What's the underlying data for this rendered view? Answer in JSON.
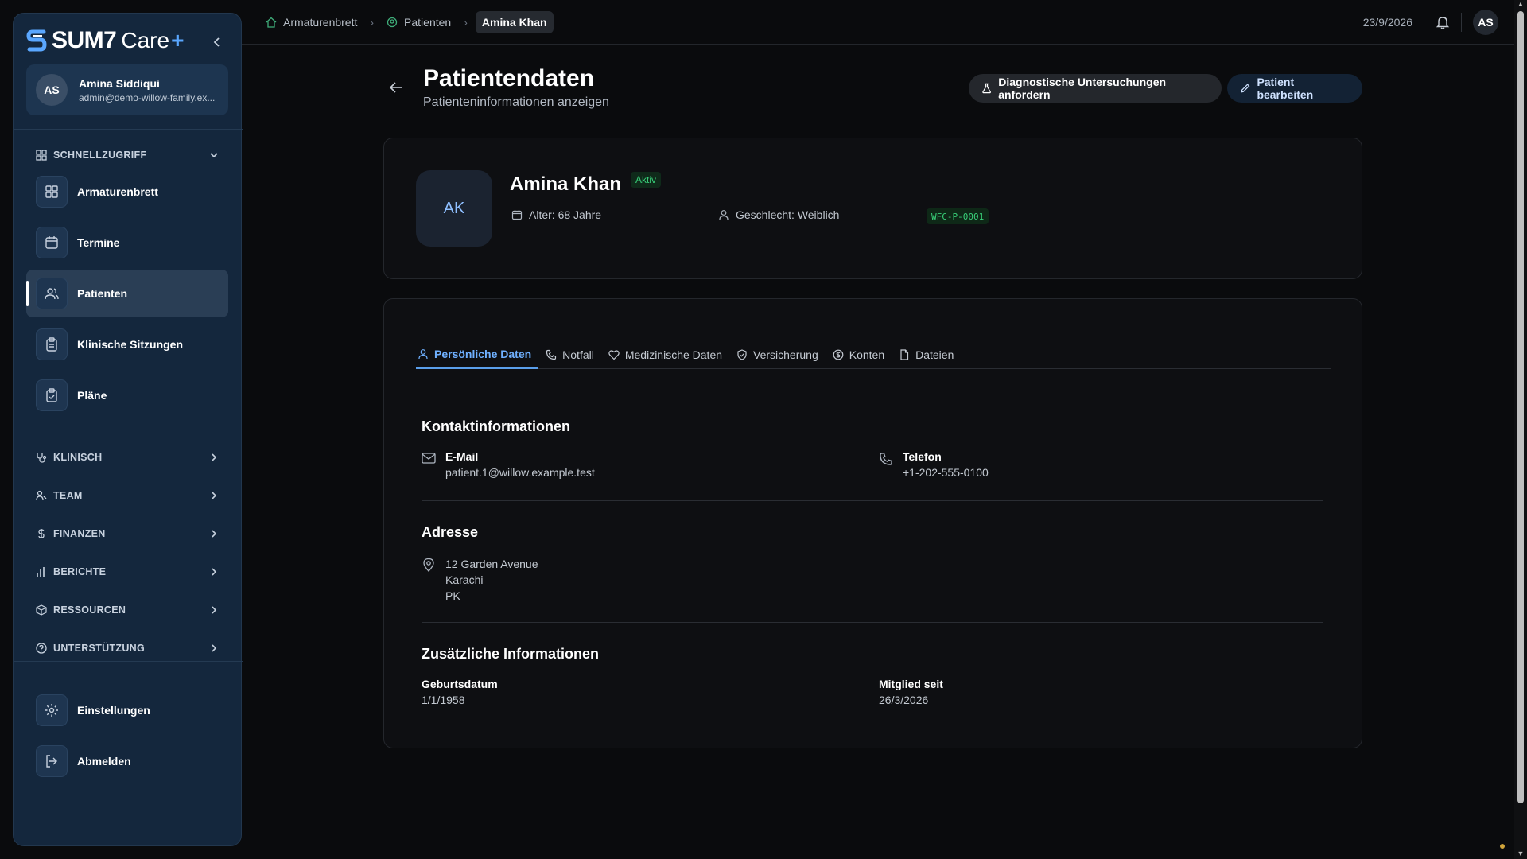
{
  "brand": {
    "logo": "SUM7",
    "product": "Care",
    "plus": "+"
  },
  "user": {
    "initials": "AS",
    "name": "Amina Siddiqui",
    "email": "admin@demo-willow-family.ex..."
  },
  "sidebar": {
    "quick_access": "SCHNELLZUGRIFF",
    "quick_items": [
      {
        "label": "Armaturenbrett",
        "icon": "dashboard-icon"
      },
      {
        "label": "Termine",
        "icon": "calendar-icon"
      },
      {
        "label": "Patienten",
        "icon": "users-icon",
        "active": true
      },
      {
        "label": "Klinische Sitzungen",
        "icon": "clipboard-icon"
      },
      {
        "label": "Pläne",
        "icon": "clipboard-check-icon"
      }
    ],
    "sections": [
      {
        "label": "KLINISCH",
        "icon": "stethoscope-icon"
      },
      {
        "label": "TEAM",
        "icon": "team-icon"
      },
      {
        "label": "FINANZEN",
        "icon": "dollar-icon"
      },
      {
        "label": "BERICHTE",
        "icon": "bar-chart-icon"
      },
      {
        "label": "RESSOURCEN",
        "icon": "package-icon"
      },
      {
        "label": "UNTERSTÜTZUNG",
        "icon": "help-icon"
      }
    ],
    "settings": "Einstellungen",
    "logout": "Abmelden"
  },
  "breadcrumb": [
    "Armaturenbrett",
    "Patienten",
    "Amina Khan"
  ],
  "topbar": {
    "date": "23/9/2026",
    "avatar": "AS"
  },
  "header": {
    "title": "Patientendaten",
    "subtitle": "Patienteninformationen anzeigen",
    "diag_button": "Diagnostische Untersuchungen anfordern",
    "edit_button": "Patient bearbeiten"
  },
  "patient": {
    "initials": "AK",
    "name": "Amina Khan",
    "status": "Aktiv",
    "age": "Alter: 68 Jahre",
    "gender": "Geschlecht: Weiblich",
    "id": "WFC-P-0001"
  },
  "tabs": [
    {
      "label": "Persönliche Daten",
      "active": true
    },
    {
      "label": "Notfall"
    },
    {
      "label": "Medizinische Daten"
    },
    {
      "label": "Versicherung"
    },
    {
      "label": "Konten"
    },
    {
      "label": "Dateien"
    }
  ],
  "contact": {
    "title": "Kontaktinformationen",
    "email_label": "E-Mail",
    "email": "patient.1@willow.example.test",
    "phone_label": "Telefon",
    "phone": "+1-202-555-0100"
  },
  "address": {
    "title": "Adresse",
    "lines": [
      "12 Garden Avenue",
      "Karachi",
      "PK"
    ]
  },
  "additional": {
    "title": "Zusätzliche Informationen",
    "dob_label": "Geburtsdatum",
    "dob": "1/1/1958",
    "member_label": "Mitglied seit",
    "member": "26/3/2026"
  }
}
